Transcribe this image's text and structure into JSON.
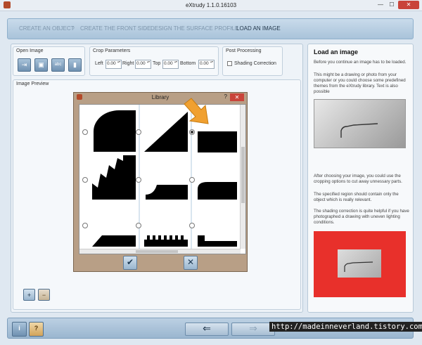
{
  "window": {
    "title": "eXtrudy 1.1.0.16103",
    "minimize": "—",
    "maximize": "☐",
    "close": "✕"
  },
  "breadcrumb": {
    "steps": [
      "CREATE AN OBJECT",
      "CREATE THE FRONT SIDE",
      "DESIGN THE SURFACE PROFILE",
      "LOAD AN IMAGE"
    ],
    "active_index": 3,
    "separator": "›"
  },
  "open_image": {
    "title": "Open Image",
    "buttons": [
      "open-file-icon",
      "image-icon",
      "text-abc-icon",
      "bookmark-library-icon"
    ],
    "abc_label": "abc"
  },
  "crop": {
    "title": "Crop Parameters",
    "left_label": "Left",
    "left_value": "0.00",
    "right_label": "Right",
    "right_value": "0.00",
    "top_label": "Top",
    "top_value": "0.00",
    "bottom_label": "Bottom",
    "bottom_value": "0.00"
  },
  "post": {
    "title": "Post Processing",
    "shading_label": "Shading Correction",
    "shading_checked": false
  },
  "preview": {
    "title": "Image Preview"
  },
  "library": {
    "title": "Library",
    "help": "?",
    "close": "✕",
    "selected_index": 2,
    "ok_glyph": "✔",
    "cancel_glyph": "✕"
  },
  "zoom": {
    "in": "+",
    "out": "−"
  },
  "help": {
    "title": "Load an image",
    "p1": "Before you continue an image has to be loaded.",
    "p2": "This might be a drawing or photo from your computer or you could choose some predefined themes from the eXtrudy library. Text is also possible",
    "p3": "After choosing your image, you could use the cropping options to cut away unnessary parts.",
    "p4": "The specified region should contain only the object which is really relevant.",
    "p5": "The shading correction is quite helpful if you have photographed a drawing with uneven lighting conditions."
  },
  "bottom": {
    "info": "i",
    "help": "?",
    "back": "⇐",
    "next": "⇒"
  },
  "watermark": "http://madeinneverland.tistory.com",
  "colors": {
    "accent_arrow": "#f0a030",
    "library_frame": "#b89f86",
    "red_bg": "#e8302b"
  }
}
